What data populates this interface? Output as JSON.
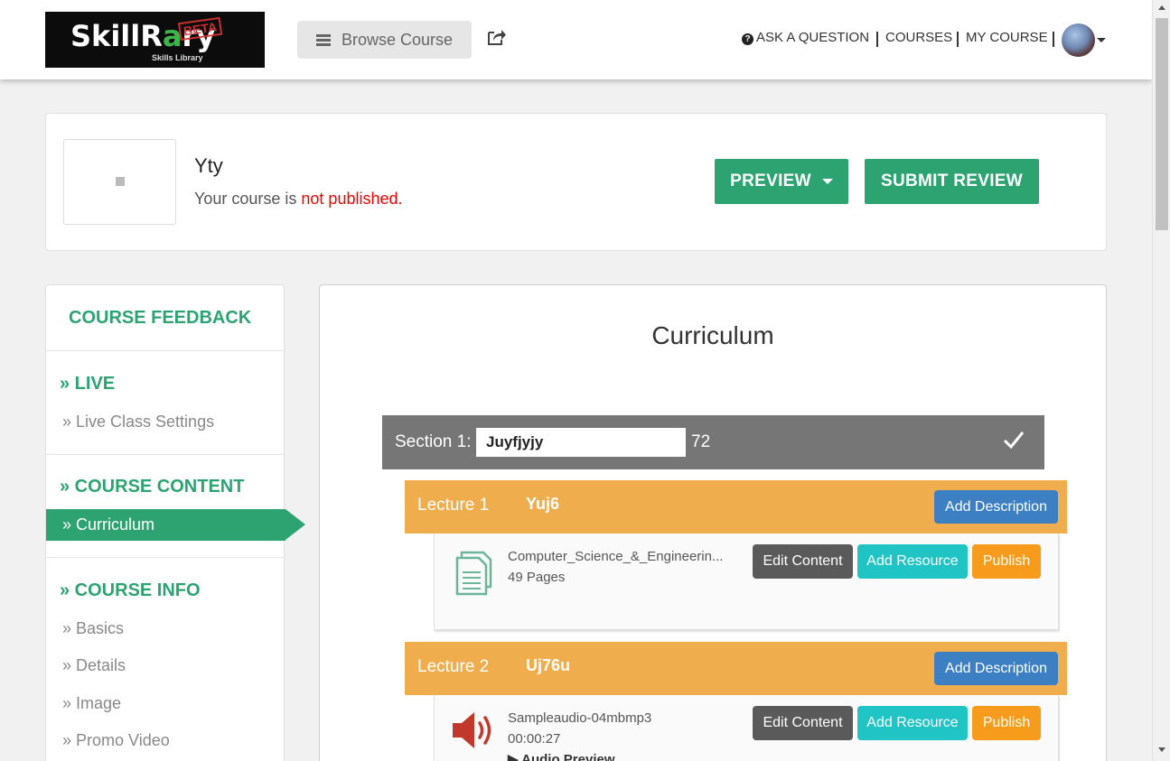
{
  "header": {
    "logo_main": "SkillR",
    "logo_main_accent": "a",
    "logo_main_tail": "ry",
    "logo_stamp": "BETA",
    "logo_sub": "Skills Library",
    "browse_label": "Browse Course",
    "nav": {
      "ask": "ASK A QUESTION",
      "courses": "COURSES",
      "my_course": "MY COURSE"
    }
  },
  "course": {
    "title": "Yty",
    "status_prefix": "Your course is ",
    "status_value": "not published.",
    "preview_label": "PREVIEW",
    "submit_label": "SUBMIT REVIEW"
  },
  "sidebar": {
    "feedback": "COURSE FEEDBACK",
    "groups": [
      {
        "title": "» LIVE",
        "items": [
          "» Live Class Settings"
        ]
      },
      {
        "title": "» COURSE CONTENT",
        "active": "» Curriculum"
      },
      {
        "title": "» COURSE INFO",
        "items": [
          "» Basics",
          "» Details",
          "» Image",
          "» Promo Video"
        ]
      }
    ]
  },
  "curriculum": {
    "title": "Curriculum",
    "section": {
      "label": "Section 1:",
      "name": "Juyfjyjy",
      "count": "72"
    },
    "lectures": [
      {
        "label": "Lecture 1",
        "name": "Yuj6",
        "add_description": "Add Description",
        "file_name": "Computer_Science_&_Engineerin...",
        "file_meta": "49 Pages",
        "icon": "document-icon",
        "edit": "Edit Content",
        "resource": "Add Resource",
        "publish": "Publish"
      },
      {
        "label": "Lecture 2",
        "name": "Uj76u",
        "add_description": "Add Description",
        "file_name": "Sampleaudio-04mbmp3",
        "file_meta": "00:00:27",
        "preview": "▶ Audio Preview",
        "icon": "speaker-icon",
        "edit": "Edit Content",
        "resource": "Add Resource",
        "publish": "Publish"
      }
    ]
  },
  "colors": {
    "green": "#2ea372",
    "orange": "#efad4d",
    "blue": "#3c7fc2",
    "cyan": "#20c4c4",
    "publish": "#f79b1c",
    "dark": "#5a5a5a",
    "section": "#767676",
    "red": "#e00000",
    "audio_icon": "#c0392b",
    "doc_icon": "#6bb59a"
  }
}
